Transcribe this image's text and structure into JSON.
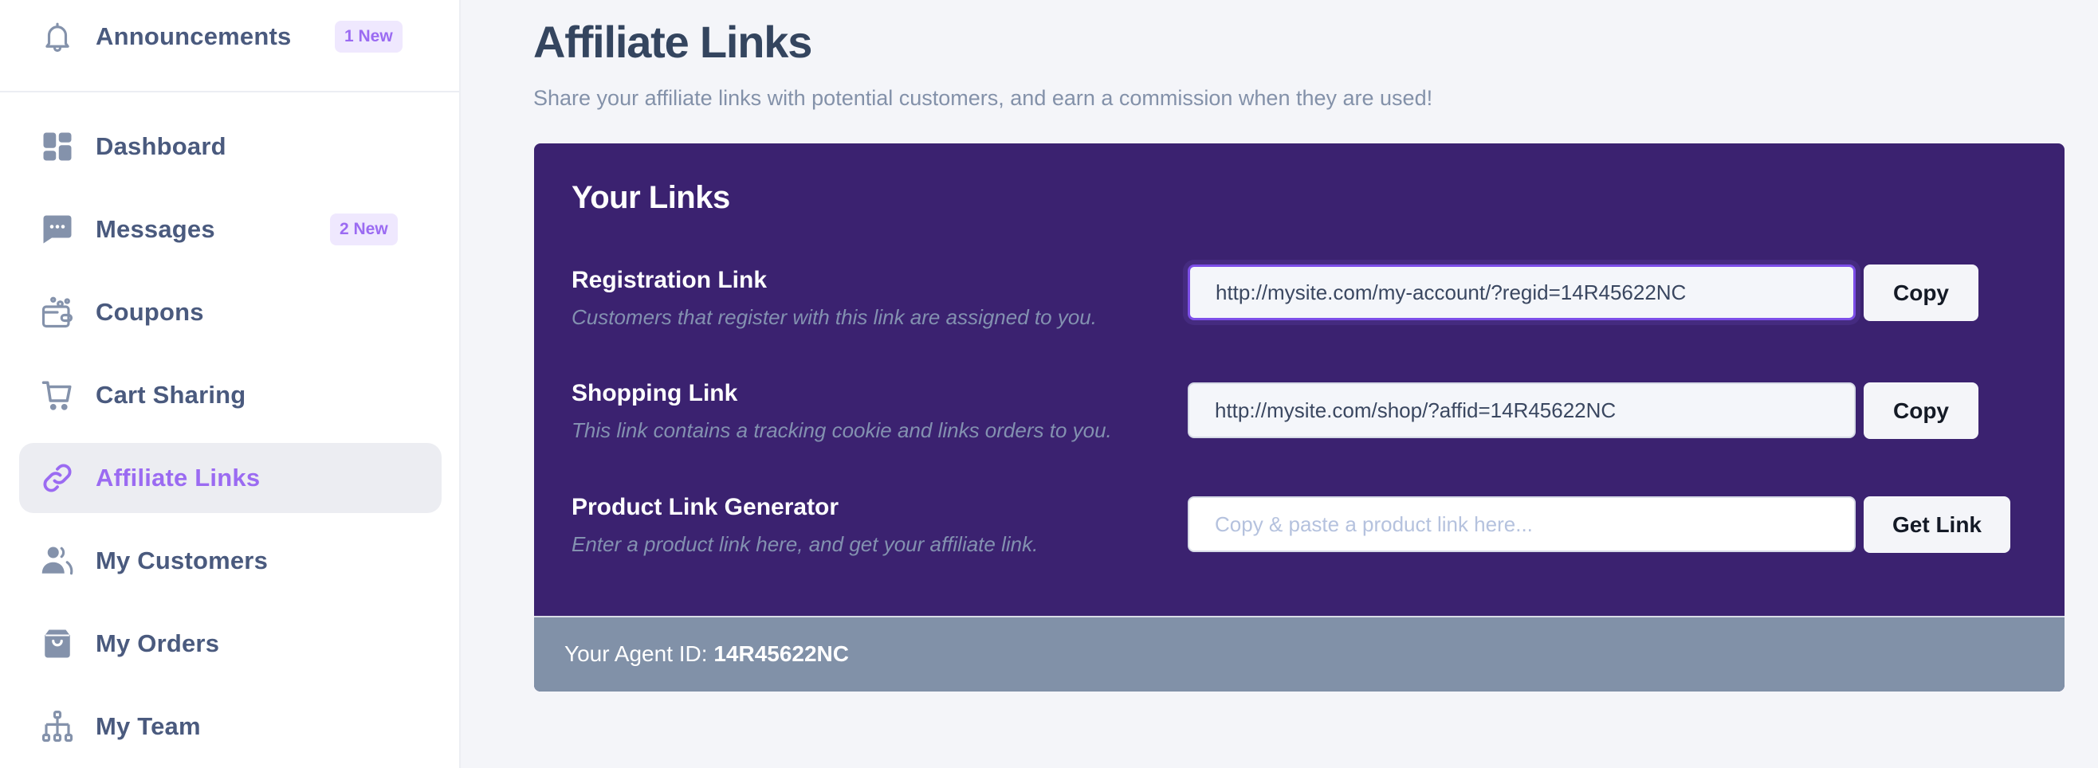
{
  "sidebar": {
    "announcements": {
      "label": "Announcements",
      "badge": "1 New",
      "icon": "bell-icon"
    },
    "items": [
      {
        "label": "Dashboard",
        "icon": "dashboard-grid-icon",
        "badge": null,
        "active": false
      },
      {
        "label": "Messages",
        "icon": "chat-bubble-icon",
        "badge": "2 New",
        "active": false
      },
      {
        "label": "Coupons",
        "icon": "wallet-coupon-icon",
        "badge": null,
        "active": false
      },
      {
        "label": "Cart Sharing",
        "icon": "cart-icon",
        "badge": null,
        "active": false
      },
      {
        "label": "Affiliate Links",
        "icon": "link-icon",
        "badge": null,
        "active": true
      },
      {
        "label": "My Customers",
        "icon": "users-icon",
        "badge": null,
        "active": false
      },
      {
        "label": "My Orders",
        "icon": "shopping-bag-icon",
        "badge": null,
        "active": false
      },
      {
        "label": "My Team",
        "icon": "org-chart-icon",
        "badge": null,
        "active": false
      }
    ]
  },
  "header": {
    "title": "Affiliate Links",
    "subtitle": "Share your affiliate links with potential customers, and earn a commission when they are used!"
  },
  "links_card": {
    "title": "Your Links",
    "rows": [
      {
        "label": "Registration Link",
        "description": "Customers that register with this link are assigned to you.",
        "value": "http://mysite.com/my-account/?regid=14R45622NC",
        "placeholder": "",
        "button": "Copy"
      },
      {
        "label": "Shopping Link",
        "description": "This link contains a tracking cookie and links orders to you.",
        "value": "http://mysite.com/shop/?affid=14R45622NC",
        "placeholder": "",
        "button": "Copy"
      },
      {
        "label": "Product Link Generator",
        "description": "Enter a product link here, and get your affiliate link.",
        "value": "",
        "placeholder": "Copy & paste a product link here...",
        "button": "Get Link"
      }
    ],
    "footer": {
      "agent_id_label": "Your Agent ID:",
      "agent_id": "14R45622NC"
    }
  },
  "colors": {
    "accent": "#9b6bf2",
    "card_bg": "#3b2270",
    "footer_bg": "#8191a8",
    "page_bg": "#f4f5f9",
    "nav_text": "#4a5a7e",
    "icon": "#8492ab"
  }
}
